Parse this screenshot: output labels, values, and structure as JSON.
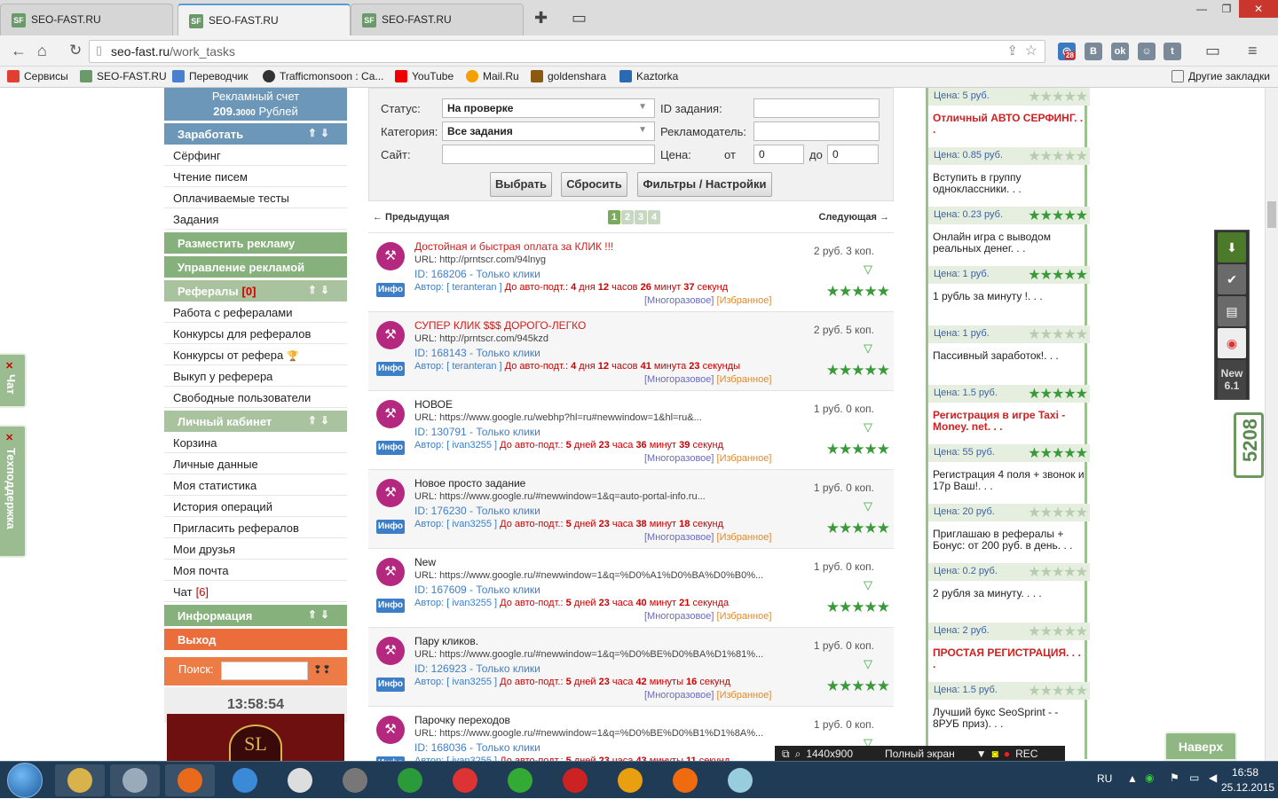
{
  "browser": {
    "tabs": [
      {
        "label": "SEO-FAST.RU",
        "icon": "SF"
      },
      {
        "label": "SEO-FAST.RU",
        "icon": "SF"
      },
      {
        "label": "SEO-FAST.RU",
        "icon": "SF"
      }
    ],
    "url_host": "seo-fast.ru",
    "url_path": "/work_tasks",
    "ext_badge": "28",
    "bookmarks": [
      {
        "label": "Сервисы",
        "icon": "apps-icon",
        "color": "#e04030"
      },
      {
        "label": "SEO-FAST.RU",
        "icon": "seofast-icon",
        "color": "#6a9a6a"
      },
      {
        "label": "Переводчик",
        "icon": "translate-icon",
        "color": "#4a7fd0"
      },
      {
        "label": "Trafficmonsoon : Ca...",
        "icon": "trafficmonsoon-icon",
        "color": "#333"
      },
      {
        "label": "YouTube",
        "icon": "youtube-icon",
        "color": "#e00"
      },
      {
        "label": "Mail.Ru",
        "icon": "mailru-icon",
        "color": "#f4a000"
      },
      {
        "label": "goldenshara",
        "icon": "goldenshara-icon",
        "color": "#8a5a10"
      },
      {
        "label": "Kaztorka",
        "icon": "kaztorka-icon",
        "color": "#2a6ab0"
      }
    ],
    "other_bookmarks": "Другие закладки"
  },
  "sidebar": {
    "account_label": "Рекламный счет",
    "account_value": "209.",
    "account_cents": "3000",
    "account_currency": " Рублей",
    "sections": [
      {
        "label": "Заработать",
        "style": "sb",
        "items": [
          {
            "label": "Сёрфинг"
          },
          {
            "label": "Чтение писем"
          },
          {
            "label": "Оплачиваемые тесты"
          },
          {
            "label": "Задания"
          }
        ]
      },
      {
        "label": "Разместить рекламу",
        "style": "sg",
        "items": []
      },
      {
        "label": "Управление рекламой",
        "style": "sg",
        "items": []
      },
      {
        "label": "Рефералы",
        "count": "[0]",
        "style": "sg2",
        "items": [
          {
            "label": "Работа с рефералами"
          },
          {
            "label": "Конкурсы для рефералов"
          },
          {
            "label": "Конкурсы от рефера"
          },
          {
            "label": "Выкуп у реферера"
          },
          {
            "label": "Свободные пользователи"
          }
        ]
      },
      {
        "label": "Личный кабинет",
        "style": "sg2",
        "items": [
          {
            "label": "Корзина"
          },
          {
            "label": "Личные данные"
          },
          {
            "label": "Моя статистика"
          },
          {
            "label": "История операций"
          },
          {
            "label": "Пригласить рефералов"
          },
          {
            "label": "Мои друзья"
          },
          {
            "label": "Моя почта"
          },
          {
            "label": "Чат",
            "count": "[6]"
          }
        ]
      },
      {
        "label": "Информация",
        "style": "sg",
        "items": []
      },
      {
        "label": "Выход",
        "style": "so",
        "items": []
      }
    ],
    "search_label": "Поиск:",
    "clock": "13:58:54",
    "banner_text": "SL"
  },
  "filter": {
    "status_label": "Статус:",
    "status_value": "На проверке",
    "category_label": "Категория:",
    "category_value": "Все задания",
    "site_label": "Сайт:",
    "task_id_label": "ID задания:",
    "advertiser_label": "Рекламодатель:",
    "price_label": "Цена:",
    "from_label": "от",
    "to_label": "до",
    "price_from": "0",
    "price_to": "0",
    "btn_select": "Выбрать",
    "btn_reset": "Сбросить",
    "btn_filters": "Фильтры / Настройки"
  },
  "pager": {
    "prev": "← Предыдущая",
    "next": "Следующая →",
    "pages": [
      "1",
      "2",
      "3",
      "4"
    ],
    "current": 1
  },
  "tasks": [
    {
      "title": "Достойная и быстрая оплата за КЛИК !!!",
      "title_red": true,
      "url": "URL: http://prntscr.com/94lnyg",
      "id": "ID: 168206 - Только клики",
      "author": "teranteran",
      "d": "4",
      "h": "12",
      "m": "26",
      "s": "37",
      "dw": "дня",
      "hw": "часов",
      "mw": "минут",
      "sw": "секунд",
      "price": "2 руб. 3 коп."
    },
    {
      "title": "СУПЕР КЛИК $$$ ДОРОГО-ЛЕГКО",
      "title_red": true,
      "url": "URL: http://prntscr.com/945kzd",
      "id": "ID: 168143 - Только клики",
      "author": "teranteran",
      "d": "4",
      "h": "12",
      "m": "41",
      "s": "23",
      "dw": "дня",
      "hw": "часов",
      "mw": "минута",
      "sw": "секунды",
      "price": "2 руб. 5 коп."
    },
    {
      "title": "НОВОЕ",
      "title_red": false,
      "url": "URL: https://www.google.ru/webhp?hl=ru#newwindow=1&hl=ru&...",
      "id": "ID: 130791 - Только клики",
      "author": "ivan3255",
      "d": "5",
      "h": "23",
      "m": "36",
      "s": "39",
      "dw": "дней",
      "hw": "часа",
      "mw": "минут",
      "sw": "секунд",
      "price": "1 руб. 0 коп."
    },
    {
      "title": "Новое просто задание",
      "title_red": false,
      "url": "URL: https://www.google.ru/#newwindow=1&q=auto-portal-info.ru...",
      "id": "ID: 176230 - Только клики",
      "author": "ivan3255",
      "d": "5",
      "h": "23",
      "m": "38",
      "s": "18",
      "dw": "дней",
      "hw": "часа",
      "mw": "минут",
      "sw": "секунд",
      "price": "1 руб. 0 коп."
    },
    {
      "title": "New",
      "title_red": false,
      "url": "URL: https://www.google.ru/#newwindow=1&q=%D0%A1%D0%BA%D0%B0%...",
      "id": "ID: 167609 - Только клики",
      "author": "ivan3255",
      "d": "5",
      "h": "23",
      "m": "40",
      "s": "21",
      "dw": "дней",
      "hw": "часа",
      "mw": "минут",
      "sw": "секунда",
      "price": "1 руб. 0 коп."
    },
    {
      "title": "Пару кликов.",
      "title_red": false,
      "url": "URL: https://www.google.ru/#newwindow=1&q=%D0%BE%D0%BA%D1%81%...",
      "id": "ID: 126923 - Только клики",
      "author": "ivan3255",
      "d": "5",
      "h": "23",
      "m": "42",
      "s": "16",
      "dw": "дней",
      "hw": "часа",
      "mw": "минуты",
      "sw": "секунд",
      "price": "1 руб. 0 коп."
    },
    {
      "title": "Парочку переходов",
      "title_red": false,
      "url": "URL: https://www.google.ru/#newwindow=1&q=%D0%BE%D0%B1%D1%8A%...",
      "id": "ID: 168036 - Только клики",
      "author": "ivan3255",
      "d": "5",
      "h": "23",
      "m": "43",
      "s": "11",
      "dw": "дней",
      "hw": "часа",
      "mw": "минуты",
      "sw": "секунд",
      "price": "1 руб. 0 коп."
    }
  ],
  "task_labels": {
    "info": "Инфо",
    "author_prefix": "Автор: [ ",
    "author_suffix": " ]",
    "auto_prefix": " До авто-подт.: ",
    "reusable": "[Многоразовое]",
    "favorite": "[Избранное]"
  },
  "ads": [
    {
      "title": "",
      "hot": false,
      "price": "Цена: 5 руб.",
      "rating": 0
    },
    {
      "title": "Отличный АВТО СЕРФИНГ. . .",
      "hot": true,
      "price": "Цена: 0.85 руб.",
      "rating": 0
    },
    {
      "title": "Вступить в группу одноклассники. . .",
      "hot": false,
      "price": "Цена: 0.23 руб.",
      "rating": 5
    },
    {
      "title": "Онлайн игра с выводом реальных денег. . .",
      "hot": false,
      "price": "Цена: 1 руб.",
      "rating": 5
    },
    {
      "title": "1 рубль за минуту !. . .",
      "hot": false,
      "price": "Цена: 1 руб.",
      "rating": 0
    },
    {
      "title": "Пассивный заработок!. . .",
      "hot": false,
      "price": "Цена: 1.5 руб.",
      "rating": 5
    },
    {
      "title": "Регистрация в игре Taxi - Money. net. . .",
      "hot": true,
      "price": "Цена: 55 руб.",
      "rating": 5
    },
    {
      "title": "Регистрация 4 поля + звонок и 17р Ваш!. . .",
      "hot": false,
      "price": "Цена: 20 руб.",
      "rating": 0
    },
    {
      "title": "Приглашаю в рефералы + Бонус: от 200 руб. в день. . .",
      "hot": false,
      "price": "Цена: 0.2 руб.",
      "rating": 0
    },
    {
      "title": "2 рубля за минуту. . . .",
      "hot": false,
      "price": "Цена: 2 руб.",
      "rating": 0
    },
    {
      "title": "ПРОСТАЯ РЕГИСТРАЦИЯ. . . .",
      "hot": true,
      "price": "Цена: 1.5 руб.",
      "rating": 0
    },
    {
      "title": "Лучший букс SeoSprint - - 8РУБ приз). . .",
      "hot": false,
      "price": "",
      "rating": 0
    }
  ],
  "overlays": {
    "chat_tab": "Чат",
    "support_tab": "Техподдержка",
    "dock_new": "New",
    "dock_ver": "6.1",
    "counter": "5208",
    "top_button": "Наверх",
    "rec_size": "1440x900",
    "rec_mode": "Полный экран",
    "rec_label": "REC"
  },
  "taskbar": {
    "lang": "RU",
    "time": "16:58",
    "date": "25.12.2015",
    "icons": [
      "explorer-icon",
      "calculator-icon",
      "firefox-icon",
      "downloader-icon",
      "notepad-icon",
      "media-icon",
      "utorrent-icon",
      "chrome-icon",
      "a-app-icon",
      "security-icon",
      "vivaldi-icon",
      "mail-at-icon",
      "screen-icon"
    ]
  }
}
